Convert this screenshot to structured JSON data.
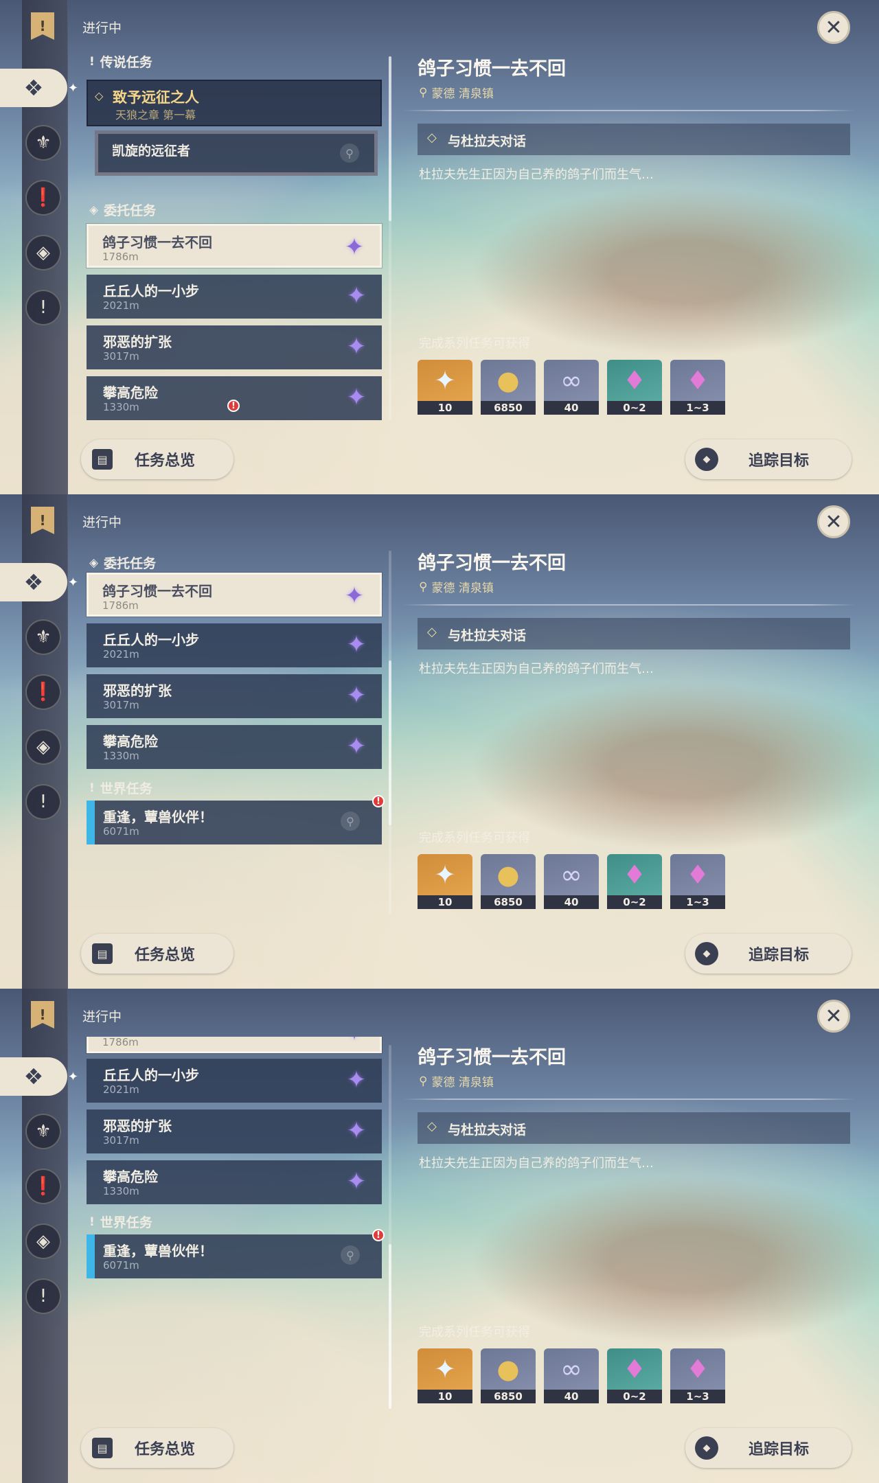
{
  "status": "进行中",
  "sections": {
    "legend": "传说任务",
    "commission": "委托任务",
    "world": "世界任务"
  },
  "legend_quest": {
    "title": "致予远征之人",
    "chapter": "天狼之章 第一幕",
    "sub": "凯旋的远征者"
  },
  "commissions": [
    {
      "title": "鸽子习惯一去不回",
      "distance": "1786m"
    },
    {
      "title": "丘丘人的一小步",
      "distance": "2021m"
    },
    {
      "title": "邪恶的扩张",
      "distance": "3017m"
    },
    {
      "title": "攀高危险",
      "distance": "1330m"
    }
  ],
  "world_quest": {
    "title": "重逢，蕈兽伙伴！",
    "distance": "6071m"
  },
  "detail": {
    "title": "鸽子习惯一去不回",
    "location": "蒙德 清泉镇",
    "objective": "与杜拉夫对话",
    "description": "杜拉夫先生正因为自己养的鸽子们而生气…",
    "rewards_label": "完成系列任务可获得",
    "rewards": [
      {
        "icon": "primogem-icon",
        "count": "10"
      },
      {
        "icon": "mora-icon",
        "count": "6850"
      },
      {
        "icon": "adventure-exp-icon",
        "count": "40"
      },
      {
        "icon": "crystal-chunk-icon",
        "count": "0~2"
      },
      {
        "icon": "crystal-cluster-icon",
        "count": "1~3"
      }
    ]
  },
  "buttons": {
    "overview": "任务总览",
    "track": "追踪目标"
  },
  "colors": {
    "legend_gold": "#f4d58a",
    "world_blue": "#3fb6e8",
    "commission_purple": "#a98cf0",
    "alert_red": "#e03b3b"
  }
}
